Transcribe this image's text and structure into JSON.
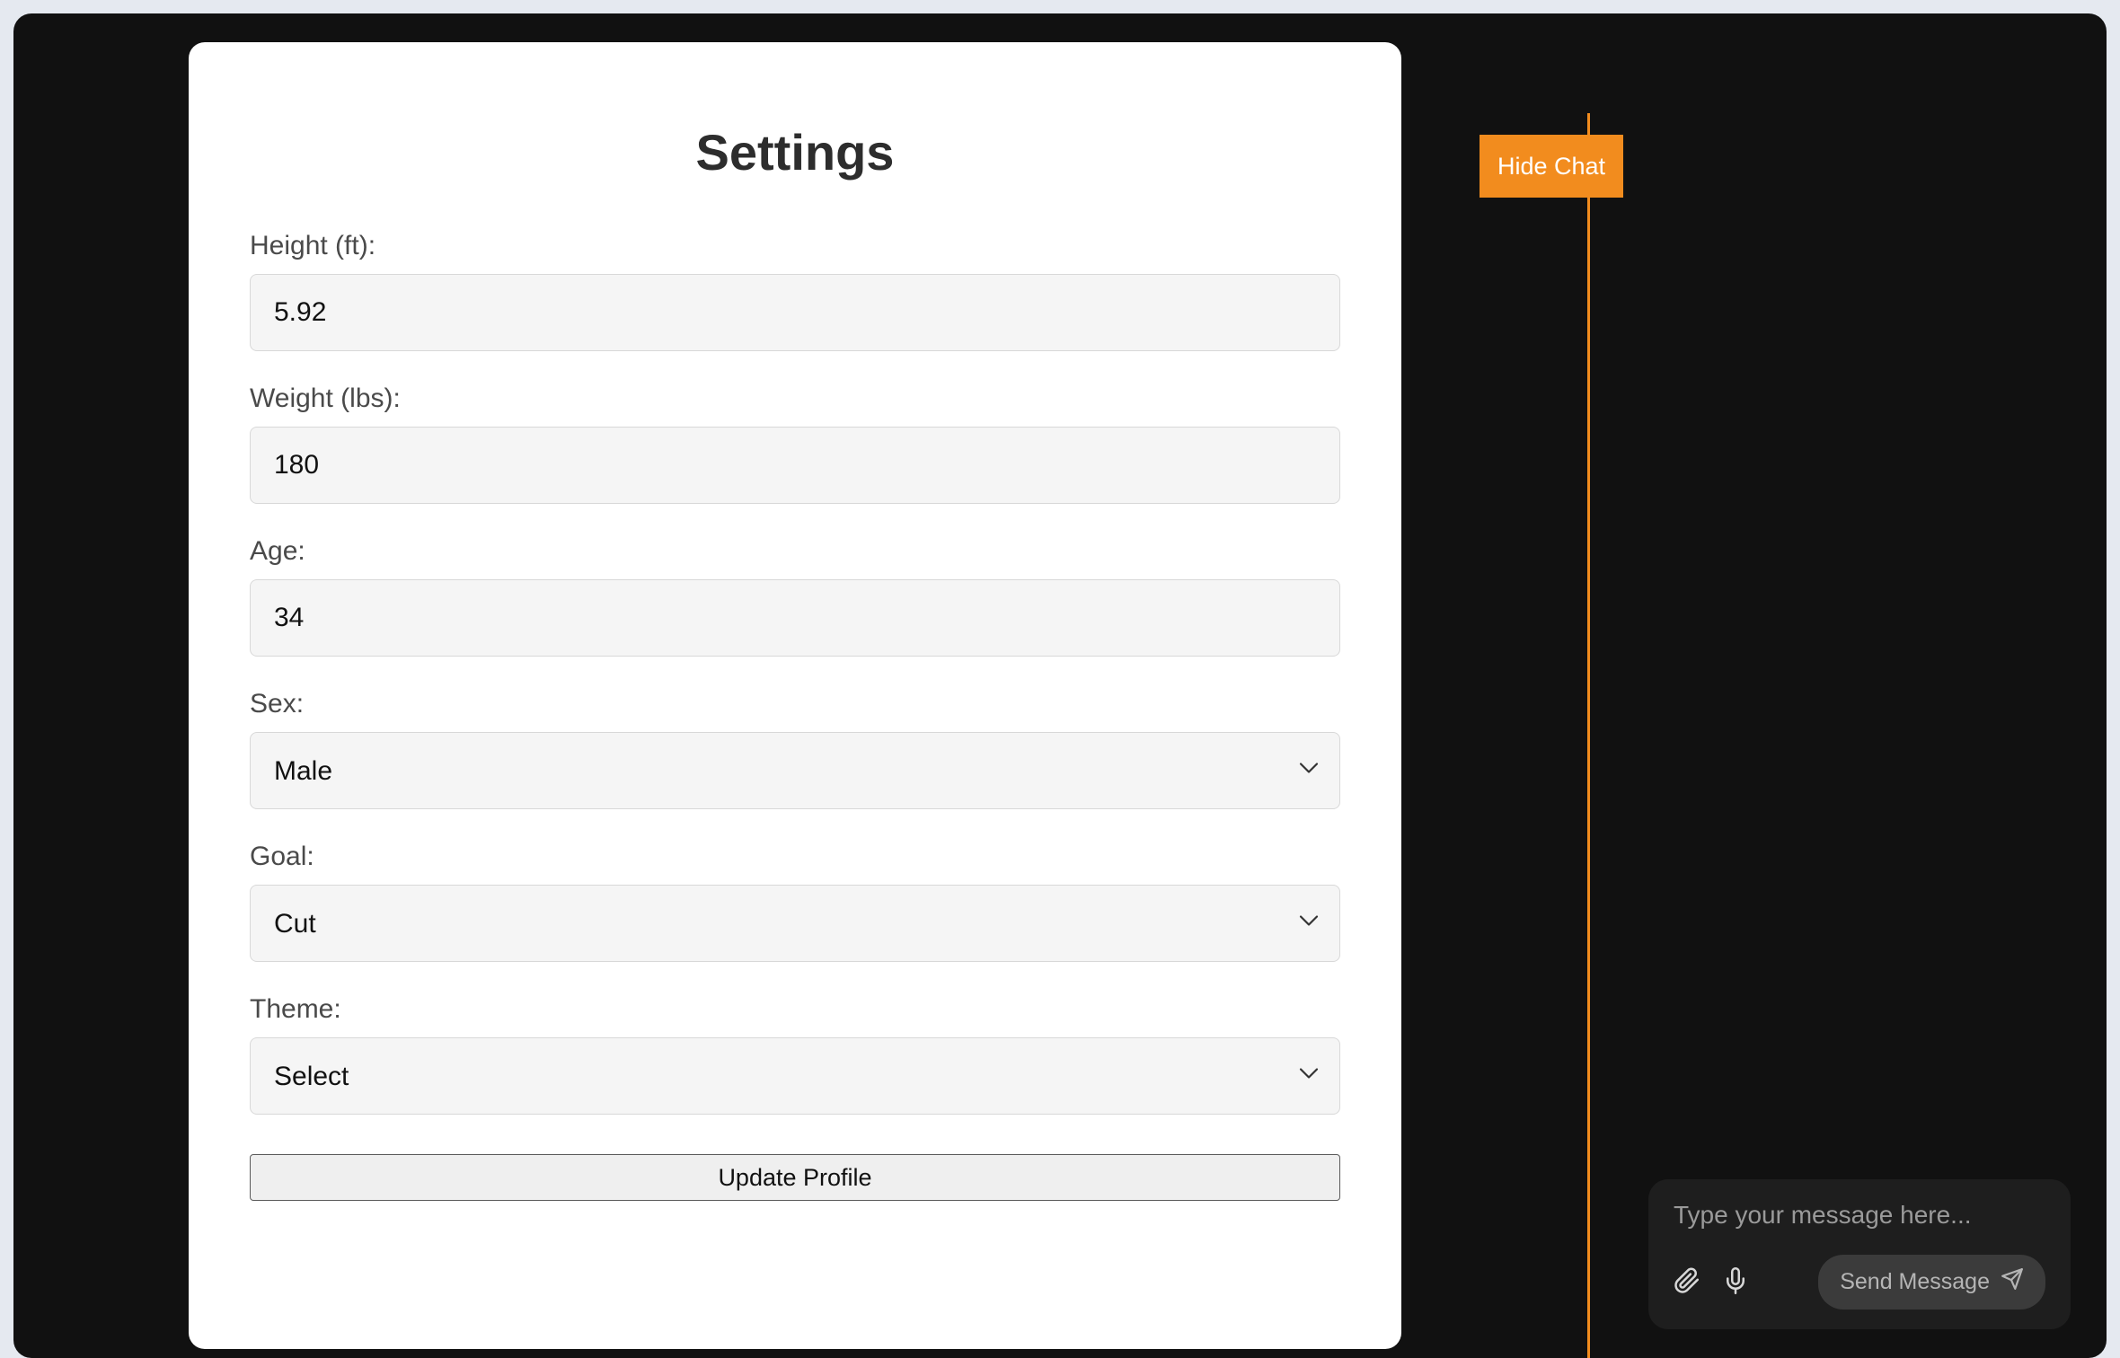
{
  "settings": {
    "title": "Settings",
    "height": {
      "label": "Height (ft):",
      "value": "5.92"
    },
    "weight": {
      "label": "Weight (lbs):",
      "value": "180"
    },
    "age": {
      "label": "Age:",
      "value": "34"
    },
    "sex": {
      "label": "Sex:",
      "value": "Male"
    },
    "goal": {
      "label": "Goal:",
      "value": "Cut"
    },
    "theme": {
      "label": "Theme:",
      "value": "Select"
    },
    "submit_label": "Update Profile"
  },
  "chat": {
    "hide_label": "Hide Chat",
    "input_placeholder": "Type your message here...",
    "send_label": "Send Message"
  }
}
